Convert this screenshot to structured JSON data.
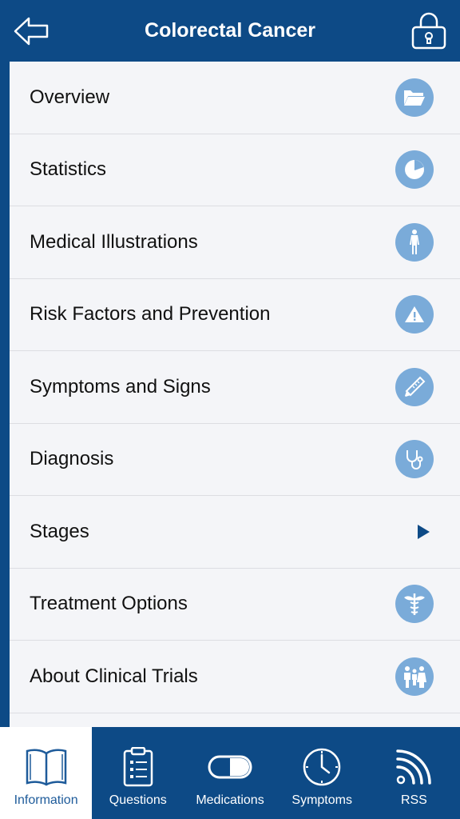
{
  "header": {
    "title": "Colorectal Cancer",
    "back_icon": "back-arrow-icon",
    "lock_icon": "lock-icon"
  },
  "colors": {
    "primary": "#0d4a86",
    "icon_circle": "#7aabd9",
    "background": "#f4f5f8",
    "active_tab_text": "#1e5b9a"
  },
  "menu": {
    "items": [
      {
        "label": "Overview",
        "icon": "folder-icon"
      },
      {
        "label": "Statistics",
        "icon": "pie-chart-icon"
      },
      {
        "label": "Medical Illustrations",
        "icon": "body-figure-icon"
      },
      {
        "label": "Risk Factors and Prevention",
        "icon": "warning-icon"
      },
      {
        "label": "Symptoms and Signs",
        "icon": "thermometer-icon"
      },
      {
        "label": "Diagnosis",
        "icon": "stethoscope-icon"
      },
      {
        "label": "Stages",
        "icon": "play-arrow-icon"
      },
      {
        "label": "Treatment Options",
        "icon": "caduceus-icon"
      },
      {
        "label": "About Clinical Trials",
        "icon": "people-icon"
      }
    ]
  },
  "tabs": [
    {
      "label": "Information",
      "icon": "book-icon",
      "active": true
    },
    {
      "label": "Questions",
      "icon": "clipboard-icon",
      "active": false
    },
    {
      "label": "Medications",
      "icon": "pill-icon",
      "active": false
    },
    {
      "label": "Symptoms",
      "icon": "clock-icon",
      "active": false
    },
    {
      "label": "RSS",
      "icon": "rss-icon",
      "active": false
    }
  ]
}
